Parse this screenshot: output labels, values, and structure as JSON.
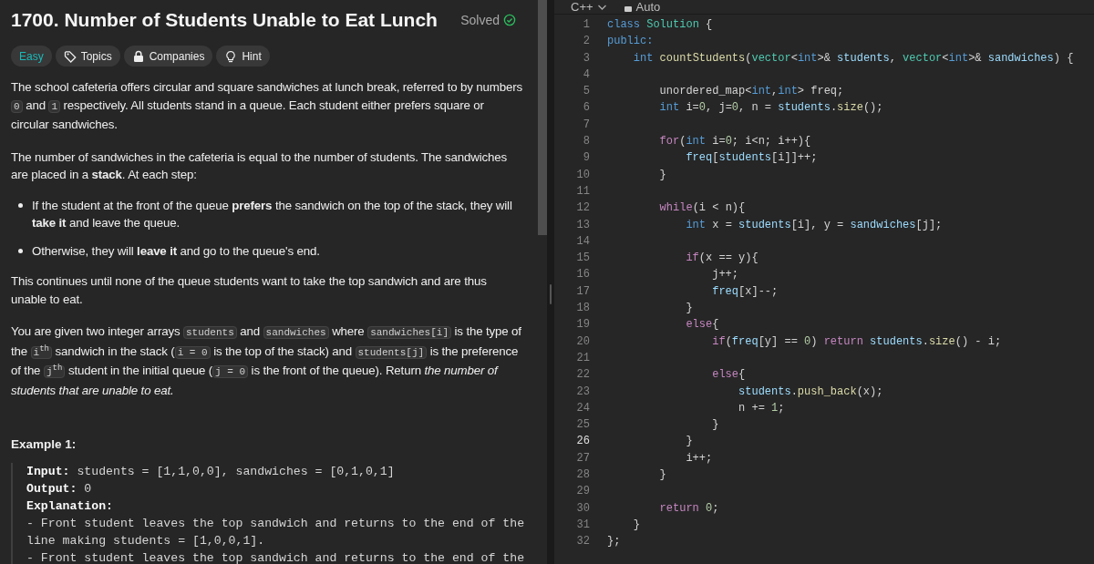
{
  "problem": {
    "title": "1700. Number of Students Unable to Eat Lunch",
    "status": "Solved",
    "tags": [
      {
        "kind": "difficulty",
        "label": "Easy"
      },
      {
        "kind": "topics",
        "label": "Topics"
      },
      {
        "kind": "companies",
        "label": "Companies"
      },
      {
        "kind": "hint",
        "label": "Hint"
      }
    ],
    "description": [
      {
        "kind": "paragraph",
        "parts": [
          {
            "kind": "text",
            "s": "The school cafeteria offers circular and square sandwiches at lunch break, referred to by numbers "
          },
          {
            "kind": "code",
            "s": "0"
          },
          {
            "kind": "text",
            "s": " and "
          },
          {
            "kind": "code",
            "s": "1"
          },
          {
            "kind": "text",
            "s": " respectively. All students stand in a queue. Each student either prefers square or circular sandwiches."
          }
        ]
      },
      {
        "kind": "paragraph",
        "parts": [
          {
            "kind": "text",
            "s": "The number of sandwiches in the cafeteria is equal to the number of students. The sandwiches are placed in a **stack**. At each step:"
          }
        ]
      },
      {
        "kind": "bullets",
        "items": [
          "If the student at the front of the queue **prefers** the sandwich on the top of the stack, they will **take it** and leave the queue.",
          "Otherwise, they will **leave it** and go to the queue's end."
        ]
      },
      {
        "kind": "paragraph",
        "parts": [
          {
            "kind": "text",
            "s": "This continues until none of the queue students want to take the top sandwich and are thus unable to eat."
          }
        ]
      },
      {
        "kind": "paragraph",
        "parts": [
          {
            "kind": "text",
            "s": "You are given two integer arrays "
          },
          {
            "kind": "code",
            "s": "students"
          },
          {
            "kind": "text",
            "s": " and "
          },
          {
            "kind": "code",
            "s": "sandwiches"
          },
          {
            "kind": "text",
            "s": " where "
          },
          {
            "kind": "code",
            "s": "sandwiches[i]"
          },
          {
            "kind": "text",
            "s": " is the type of the "
          },
          {
            "kind": "code",
            "s": "i$^{th}$"
          },
          {
            "kind": "text",
            "s": " sandwich in the stack ("
          },
          {
            "kind": "code",
            "s": "i = 0"
          },
          {
            "kind": "text",
            "s": " is the top of the stack) and "
          },
          {
            "kind": "code",
            "s": "students[j]"
          },
          {
            "kind": "text",
            "s": " is the preference of the "
          },
          {
            "kind": "code",
            "s": "j$^{th}$"
          },
          {
            "kind": "text",
            "s": " student in the initial queue ("
          },
          {
            "kind": "code",
            "s": "j = 0"
          },
          {
            "kind": "text",
            "s": " is the front of the queue). Return *the number of students that are unable to eat.*"
          }
        ]
      }
    ],
    "example": {
      "title": "Example 1:",
      "lines": [
        "**Input:** students = [1,1,0,0], sandwiches = [0,1,0,1]",
        "**Output:** 0",
        "**Explanation:**",
        "- Front student leaves the top sandwich and returns to the end of the line making students = [1,0,0,1].",
        "- Front student leaves the top sandwich and returns to the end of the"
      ]
    }
  },
  "editor": {
    "language": "C++",
    "mode": "Auto",
    "lines": [
      {
        "n": "1",
        "active": false,
        "tokens": [
          {
            "text": "class",
            "kind": "keyword"
          },
          {
            "text": " Solution",
            "kind": "type"
          },
          {
            "text": " {",
            "kind": "plain"
          }
        ]
      },
      {
        "n": "2",
        "active": false,
        "tokens": [
          {
            "text": "public:",
            "kind": "keyword"
          }
        ]
      },
      {
        "n": "3",
        "active": false,
        "tokens": [
          {
            "text": "    int",
            "kind": "keyword"
          },
          {
            "text": " countStudents",
            "kind": "function"
          },
          {
            "text": "(",
            "kind": "plain"
          },
          {
            "text": "vector",
            "kind": "type"
          },
          {
            "text": "<",
            "kind": "plain"
          },
          {
            "text": "int",
            "kind": "keyword"
          },
          {
            "text": ">& ",
            "kind": "plain"
          },
          {
            "text": "students",
            "kind": "variable"
          },
          {
            "text": ", ",
            "kind": "plain"
          },
          {
            "text": "vector",
            "kind": "type"
          },
          {
            "text": "<",
            "kind": "plain"
          },
          {
            "text": "int",
            "kind": "keyword"
          },
          {
            "text": ">& ",
            "kind": "plain"
          },
          {
            "text": "sandwiches",
            "kind": "variable"
          },
          {
            "text": ") {",
            "kind": "plain"
          }
        ]
      },
      {
        "n": "4",
        "active": false
      },
      {
        "n": "5",
        "active": false,
        "tokens": [
          {
            "text": "        unordered_map<",
            "kind": "plain"
          },
          {
            "text": "int",
            "kind": "keyword"
          },
          {
            "text": ",",
            "kind": "plain"
          },
          {
            "text": "int",
            "kind": "keyword"
          },
          {
            "text": "> freq;",
            "kind": "plain"
          }
        ]
      },
      {
        "n": "6",
        "active": false,
        "tokens": [
          {
            "text": "        int",
            "kind": "keyword"
          },
          {
            "text": " i=",
            "kind": "plain"
          },
          {
            "text": "0",
            "kind": "number"
          },
          {
            "text": ", j=",
            "kind": "plain"
          },
          {
            "text": "0",
            "kind": "number"
          },
          {
            "text": ", n = ",
            "kind": "plain"
          },
          {
            "text": "students",
            "kind": "variable"
          },
          {
            "text": ".",
            "kind": "plain"
          },
          {
            "text": "size",
            "kind": "function"
          },
          {
            "text": "();",
            "kind": "plain"
          }
        ]
      },
      {
        "n": "7",
        "active": false
      },
      {
        "n": "8",
        "active": false,
        "tokens": [
          {
            "text": "        for",
            "kind": "control"
          },
          {
            "text": "(",
            "kind": "plain"
          },
          {
            "text": "int",
            "kind": "keyword"
          },
          {
            "text": " i=",
            "kind": "plain"
          },
          {
            "text": "0",
            "kind": "number"
          },
          {
            "text": "; i<n; i++){",
            "kind": "plain"
          }
        ]
      },
      {
        "n": "9",
        "active": false,
        "tokens": [
          {
            "text": "            freq",
            "kind": "variable"
          },
          {
            "text": "[",
            "kind": "plain"
          },
          {
            "text": "students",
            "kind": "variable"
          },
          {
            "text": "[i]]++;",
            "kind": "plain"
          }
        ]
      },
      {
        "n": "10",
        "active": false,
        "tokens": [
          {
            "text": "        }",
            "kind": "plain"
          }
        ]
      },
      {
        "n": "11",
        "active": false
      },
      {
        "n": "12",
        "active": false,
        "tokens": [
          {
            "text": "        while",
            "kind": "control"
          },
          {
            "text": "(i < n){",
            "kind": "plain"
          }
        ]
      },
      {
        "n": "13",
        "active": false,
        "tokens": [
          {
            "text": "            int",
            "kind": "keyword"
          },
          {
            "text": " x = ",
            "kind": "plain"
          },
          {
            "text": "students",
            "kind": "variable"
          },
          {
            "text": "[i], y = ",
            "kind": "plain"
          },
          {
            "text": "sandwiches",
            "kind": "variable"
          },
          {
            "text": "[j];",
            "kind": "plain"
          }
        ]
      },
      {
        "n": "14",
        "active": false
      },
      {
        "n": "15",
        "active": false,
        "tokens": [
          {
            "text": "            if",
            "kind": "control"
          },
          {
            "text": "(x == y){",
            "kind": "plain"
          }
        ]
      },
      {
        "n": "16",
        "active": false,
        "tokens": [
          {
            "text": "                j++;",
            "kind": "plain"
          }
        ]
      },
      {
        "n": "17",
        "active": false,
        "tokens": [
          {
            "text": "                freq",
            "kind": "variable"
          },
          {
            "text": "[x]--;",
            "kind": "plain"
          }
        ]
      },
      {
        "n": "18",
        "active": false,
        "tokens": [
          {
            "text": "            }",
            "kind": "plain"
          }
        ]
      },
      {
        "n": "19",
        "active": false,
        "tokens": [
          {
            "text": "            else",
            "kind": "control"
          },
          {
            "text": "{",
            "kind": "plain"
          }
        ]
      },
      {
        "n": "20",
        "active": false,
        "tokens": [
          {
            "text": "                if",
            "kind": "control"
          },
          {
            "text": "(",
            "kind": "plain"
          },
          {
            "text": "freq",
            "kind": "variable"
          },
          {
            "text": "[y] == ",
            "kind": "plain"
          },
          {
            "text": "0",
            "kind": "number"
          },
          {
            "text": ") ",
            "kind": "plain"
          },
          {
            "text": "return",
            "kind": "control"
          },
          {
            "text": " students",
            "kind": "variable"
          },
          {
            "text": ".",
            "kind": "plain"
          },
          {
            "text": "size",
            "kind": "function"
          },
          {
            "text": "() - i;",
            "kind": "plain"
          }
        ]
      },
      {
        "n": "21",
        "active": false
      },
      {
        "n": "22",
        "active": false,
        "tokens": [
          {
            "text": "                else",
            "kind": "control"
          },
          {
            "text": "{",
            "kind": "plain"
          }
        ]
      },
      {
        "n": "23",
        "active": false,
        "tokens": [
          {
            "text": "                    students",
            "kind": "variable"
          },
          {
            "text": ".",
            "kind": "plain"
          },
          {
            "text": "push_back",
            "kind": "function"
          },
          {
            "text": "(x);",
            "kind": "plain"
          }
        ]
      },
      {
        "n": "24",
        "active": false,
        "tokens": [
          {
            "text": "                    n += ",
            "kind": "plain"
          },
          {
            "text": "1",
            "kind": "number"
          },
          {
            "text": ";",
            "kind": "plain"
          }
        ]
      },
      {
        "n": "25",
        "active": false,
        "tokens": [
          {
            "text": "                }",
            "kind": "plain"
          }
        ]
      },
      {
        "n": "26",
        "active": true,
        "tokens": [
          {
            "text": "            }",
            "kind": "plain"
          }
        ]
      },
      {
        "n": "27",
        "active": false,
        "tokens": [
          {
            "text": "            i++;",
            "kind": "plain"
          }
        ]
      },
      {
        "n": "28",
        "active": false,
        "tokens": [
          {
            "text": "        }",
            "kind": "plain"
          }
        ]
      },
      {
        "n": "29",
        "active": false
      },
      {
        "n": "30",
        "active": false,
        "tokens": [
          {
            "text": "        return",
            "kind": "control"
          },
          {
            "text": " 0",
            "kind": "number"
          },
          {
            "text": ";",
            "kind": "plain"
          }
        ]
      },
      {
        "n": "31",
        "active": false,
        "tokens": [
          {
            "text": "    }",
            "kind": "plain"
          }
        ]
      },
      {
        "n": "32",
        "active": false,
        "tokens": [
          {
            "text": "};",
            "kind": "plain"
          }
        ]
      }
    ]
  }
}
